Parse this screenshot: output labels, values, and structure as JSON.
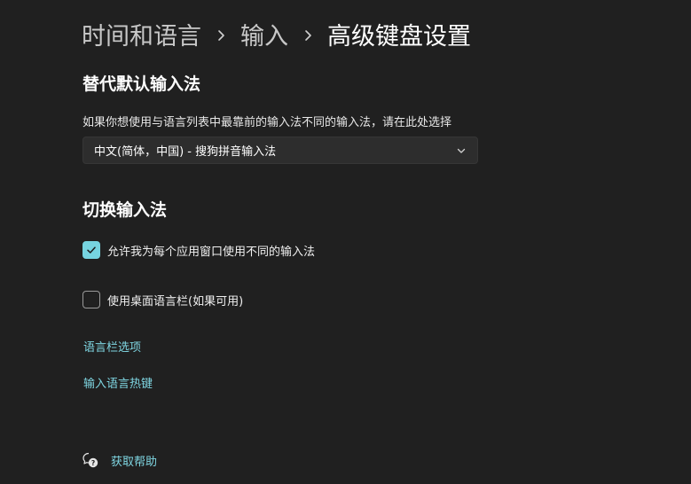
{
  "breadcrumb": {
    "items": [
      "时间和语言",
      "输入",
      "高级键盘设置"
    ]
  },
  "override_section": {
    "title": "替代默认输入法",
    "description": "如果你想使用与语言列表中最靠前的输入法不同的输入法，请在此处选择",
    "dropdown_value": "中文(简体，中国) - 搜狗拼音输入法"
  },
  "switch_section": {
    "title": "切换输入法",
    "options": [
      {
        "label": "允许我为每个应用窗口使用不同的输入法",
        "checked": true
      },
      {
        "label": "使用桌面语言栏(如果可用)",
        "checked": false
      }
    ]
  },
  "links": {
    "language_bar_options": "语言栏选项",
    "input_language_hotkeys": "输入语言热键"
  },
  "help": {
    "label": "获取帮助"
  },
  "icons": {
    "breadcrumb_separator": "chevron-right-icon",
    "dropdown": "chevron-down-icon",
    "checkbox": "checkmark-icon",
    "help": "help-chat-icon"
  },
  "colors": {
    "background": "#202020",
    "accent": "#76d4e0",
    "link": "#7fd6e2"
  }
}
